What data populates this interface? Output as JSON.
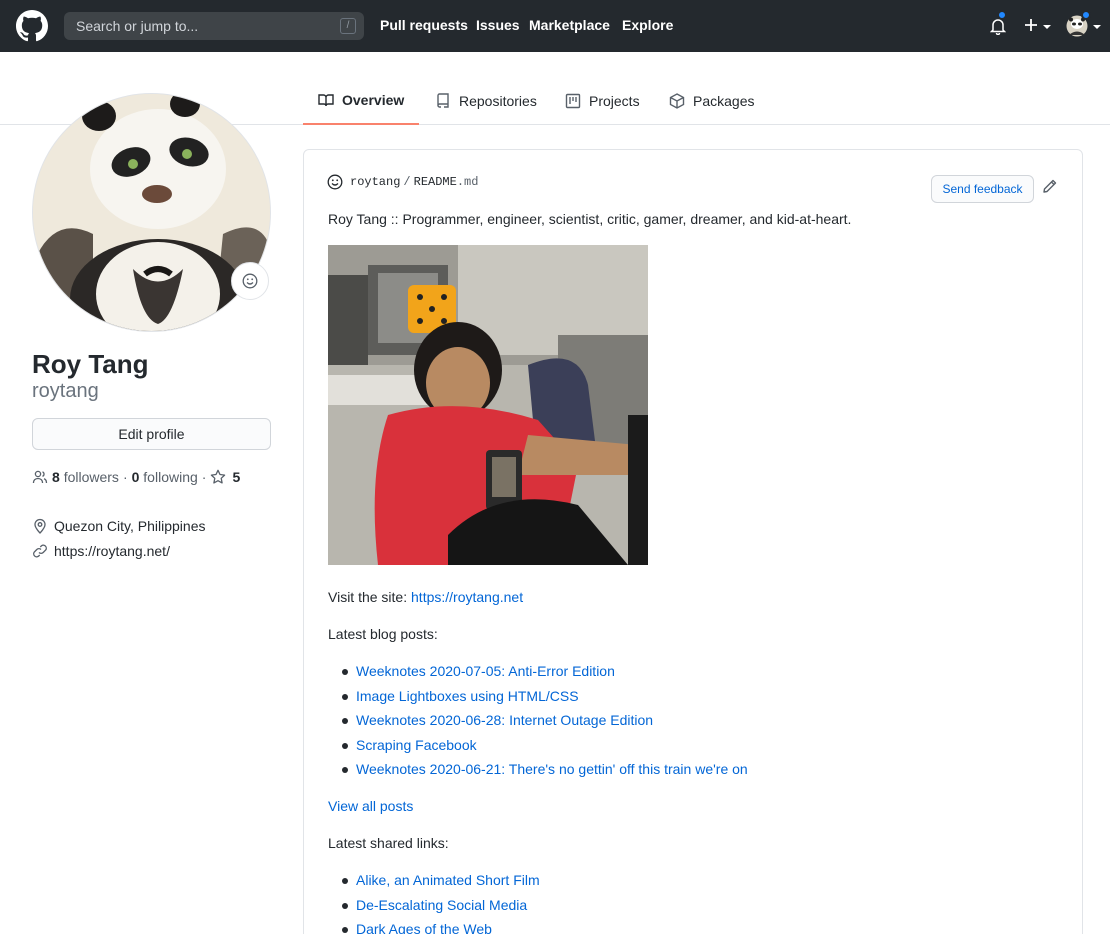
{
  "header": {
    "search_placeholder": "Search or jump to...",
    "search_shortcut": "/",
    "nav": [
      "Pull requests",
      "Issues",
      "Marketplace",
      "Explore"
    ],
    "icons": [
      "github-logo-icon",
      "bell-icon",
      "plus-icon",
      "avatar"
    ]
  },
  "tabs": [
    {
      "label": "Overview",
      "icon": "book-icon",
      "selected": true
    },
    {
      "label": "Repositories",
      "icon": "repo-icon",
      "selected": false
    },
    {
      "label": "Projects",
      "icon": "project-icon",
      "selected": false
    },
    {
      "label": "Packages",
      "icon": "package-icon",
      "selected": false
    }
  ],
  "profile": {
    "name": "Roy Tang",
    "username": "roytang",
    "edit_label": "Edit profile",
    "followers_count": "8",
    "followers_label": "followers",
    "following_count": "0",
    "following_label": "following",
    "stars_count": "5",
    "location": "Quezon City, Philippines",
    "website": "https://roytang.net/"
  },
  "readme": {
    "owner": "roytang",
    "sep": "/",
    "file_base": "README",
    "file_ext": ".md",
    "feedback_label": "Send feedback",
    "intro": "Roy Tang :: Programmer, engineer, scientist, critic, gamer, dreamer, and kid-at-heart.",
    "visit_label": "Visit the site: ",
    "visit_link": "https://roytang.net",
    "blog_heading": "Latest blog posts:",
    "blog_posts": [
      "Weeknotes 2020-07-05: Anti-Error Edition",
      "Image Lightboxes using HTML/CSS",
      "Weeknotes 2020-06-28: Internet Outage Edition",
      "Scraping Facebook",
      "Weeknotes 2020-06-21: There's no gettin' off this train we're on"
    ],
    "view_all": "View all posts",
    "links_heading": "Latest shared links:",
    "shared_links": [
      "Alike, an Animated Short Film",
      "De-Escalating Social Media",
      "Dark Ages of the Web"
    ]
  },
  "colors": {
    "header_bg": "#24292e",
    "link": "#0366d6",
    "tab_underline": "#f9826c",
    "notification_dot": "#2188ff"
  }
}
